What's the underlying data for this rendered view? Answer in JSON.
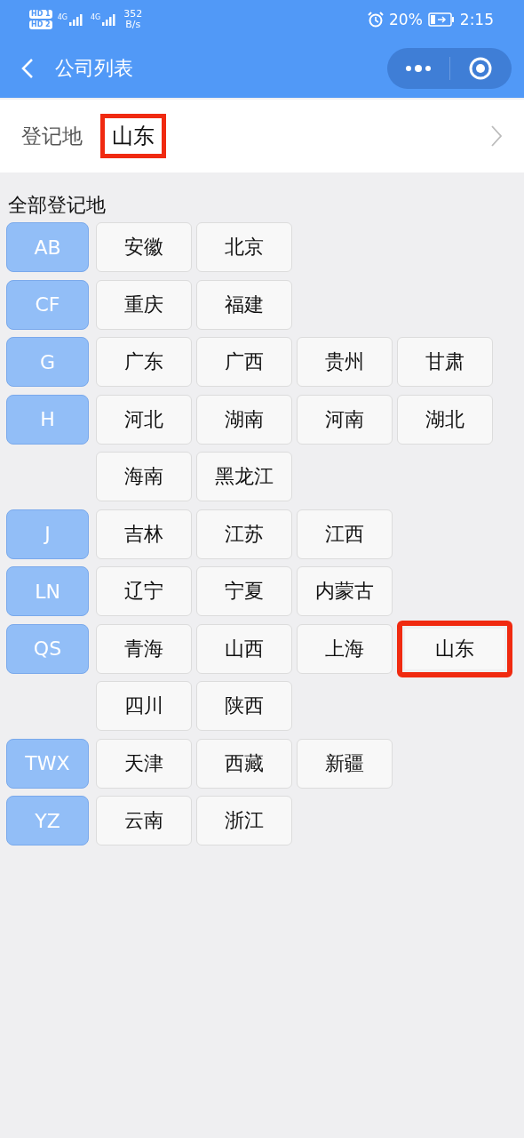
{
  "status_bar": {
    "sim_badges": [
      "HD 1",
      "HD 2"
    ],
    "networks": [
      "4G",
      "4G"
    ],
    "speed": [
      "352",
      "B/s"
    ],
    "battery": "20%",
    "time": "2:15"
  },
  "nav": {
    "title": "公司列表"
  },
  "field": {
    "label": "登记地",
    "value": "山东",
    "highlighted": true
  },
  "section_title": "全部登记地",
  "groups": [
    {
      "letter": "AB",
      "provinces": [
        {
          "name": "安徽",
          "highlighted": false
        },
        {
          "name": "北京",
          "highlighted": false
        }
      ]
    },
    {
      "letter": "CF",
      "provinces": [
        {
          "name": "重庆",
          "highlighted": false
        },
        {
          "name": "福建",
          "highlighted": false
        }
      ]
    },
    {
      "letter": "G",
      "provinces": [
        {
          "name": "广东",
          "highlighted": false
        },
        {
          "name": "广西",
          "highlighted": false
        },
        {
          "name": "贵州",
          "highlighted": false
        },
        {
          "name": "甘肃",
          "highlighted": false
        }
      ]
    },
    {
      "letter": "H",
      "provinces": [
        {
          "name": "河北",
          "highlighted": false
        },
        {
          "name": "湖南",
          "highlighted": false
        },
        {
          "name": "河南",
          "highlighted": false
        },
        {
          "name": "湖北",
          "highlighted": false
        },
        {
          "name": "海南",
          "highlighted": false
        },
        {
          "name": "黑龙江",
          "highlighted": false
        }
      ]
    },
    {
      "letter": "J",
      "provinces": [
        {
          "name": "吉林",
          "highlighted": false
        },
        {
          "name": "江苏",
          "highlighted": false
        },
        {
          "name": "江西",
          "highlighted": false
        }
      ]
    },
    {
      "letter": "LN",
      "provinces": [
        {
          "name": "辽宁",
          "highlighted": false
        },
        {
          "name": "宁夏",
          "highlighted": false
        },
        {
          "name": "内蒙古",
          "highlighted": false
        }
      ]
    },
    {
      "letter": "QS",
      "provinces": [
        {
          "name": "青海",
          "highlighted": false
        },
        {
          "name": "山西",
          "highlighted": false
        },
        {
          "name": "上海",
          "highlighted": false
        },
        {
          "name": "山东",
          "highlighted": true
        },
        {
          "name": "四川",
          "highlighted": false
        },
        {
          "name": "陕西",
          "highlighted": false
        }
      ]
    },
    {
      "letter": "TWX",
      "provinces": [
        {
          "name": "天津",
          "highlighted": false
        },
        {
          "name": "西藏",
          "highlighted": false
        },
        {
          "name": "新疆",
          "highlighted": false
        }
      ]
    },
    {
      "letter": "YZ",
      "provinces": [
        {
          "name": "云南",
          "highlighted": false
        },
        {
          "name": "浙江",
          "highlighted": false
        }
      ]
    }
  ]
}
